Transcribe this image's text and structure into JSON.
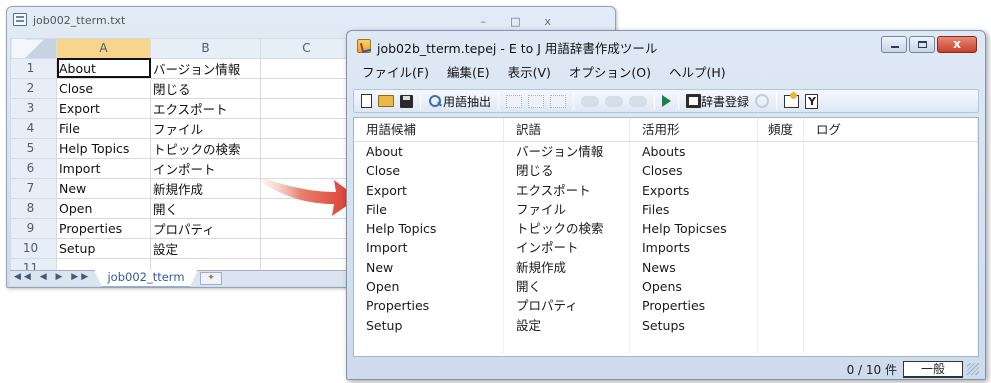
{
  "spreadsheet": {
    "title": "job002_tterm.txt",
    "window_controls": [
      "–",
      "□",
      "x"
    ],
    "columns": [
      "A",
      "B",
      "C"
    ],
    "rows": [
      {
        "num": "1",
        "a": "About",
        "b": "バージョン情報"
      },
      {
        "num": "2",
        "a": "Close",
        "b": "閉じる"
      },
      {
        "num": "3",
        "a": "Export",
        "b": "エクスポート"
      },
      {
        "num": "4",
        "a": "File",
        "b": "ファイル"
      },
      {
        "num": "5",
        "a": "Help Topics",
        "b": "トピックの検索"
      },
      {
        "num": "6",
        "a": "Import",
        "b": "インポート"
      },
      {
        "num": "7",
        "a": "New",
        "b": "新規作成"
      },
      {
        "num": "8",
        "a": "Open",
        "b": "開く"
      },
      {
        "num": "9",
        "a": "Properties",
        "b": "プロパティ"
      },
      {
        "num": "10",
        "a": "Setup",
        "b": "設定"
      },
      {
        "num": "11",
        "a": "",
        "b": ""
      }
    ],
    "sheet_tab": "job002_tterm",
    "tab_nav": "◀◀ ◀ ▶ ▶▶"
  },
  "tool": {
    "title": "job02b_tterm.tepej - E to J 用語辞書作成ツール",
    "menu": [
      "ファイル(F)",
      "編集(E)",
      "表示(V)",
      "オプション(O)",
      "ヘルプ(H)"
    ],
    "toolbar": {
      "extract_label": "用語抽出",
      "register_label": "辞書登録"
    },
    "headers": [
      "用語候補",
      "訳語",
      "活用形",
      "頻度",
      "ログ"
    ],
    "rows": [
      {
        "term": "About",
        "translation": "バージョン情報",
        "form": "Abouts"
      },
      {
        "term": "Close",
        "translation": "閉じる",
        "form": "Closes"
      },
      {
        "term": "Export",
        "translation": "エクスポート",
        "form": "Exports"
      },
      {
        "term": "File",
        "translation": "ファイル",
        "form": "Files"
      },
      {
        "term": "Help Topics",
        "translation": "トピックの検索",
        "form": "Help Topicses"
      },
      {
        "term": "Import",
        "translation": "インポート",
        "form": "Imports"
      },
      {
        "term": "New",
        "translation": "新規作成",
        "form": "News"
      },
      {
        "term": "Open",
        "translation": "開く",
        "form": "Opens"
      },
      {
        "term": "Properties",
        "translation": "プロパティ",
        "form": "Properties"
      },
      {
        "term": "Setup",
        "translation": "設定",
        "form": "Setups"
      }
    ],
    "status_count": "0 / 10 件",
    "status_mode": "一般"
  },
  "colors": {
    "arrow": "#d9342b",
    "accent": "#f7d58c"
  }
}
